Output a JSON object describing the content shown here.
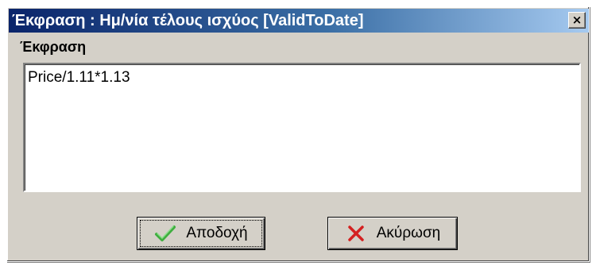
{
  "dialog": {
    "title": "Έκφραση : Ημ/νία τέλους ισχύος [ValidToDate]",
    "close_symbol": "×"
  },
  "expression": {
    "label": "Έκφραση",
    "value": "Price/1.11*1.13"
  },
  "buttons": {
    "ok": {
      "label": "Αποδοχή",
      "icon": "checkmark-icon",
      "icon_color": "#3fae3f"
    },
    "cancel": {
      "label": "Ακύρωση",
      "icon": "x-icon",
      "icon_color": "#d42020"
    }
  }
}
